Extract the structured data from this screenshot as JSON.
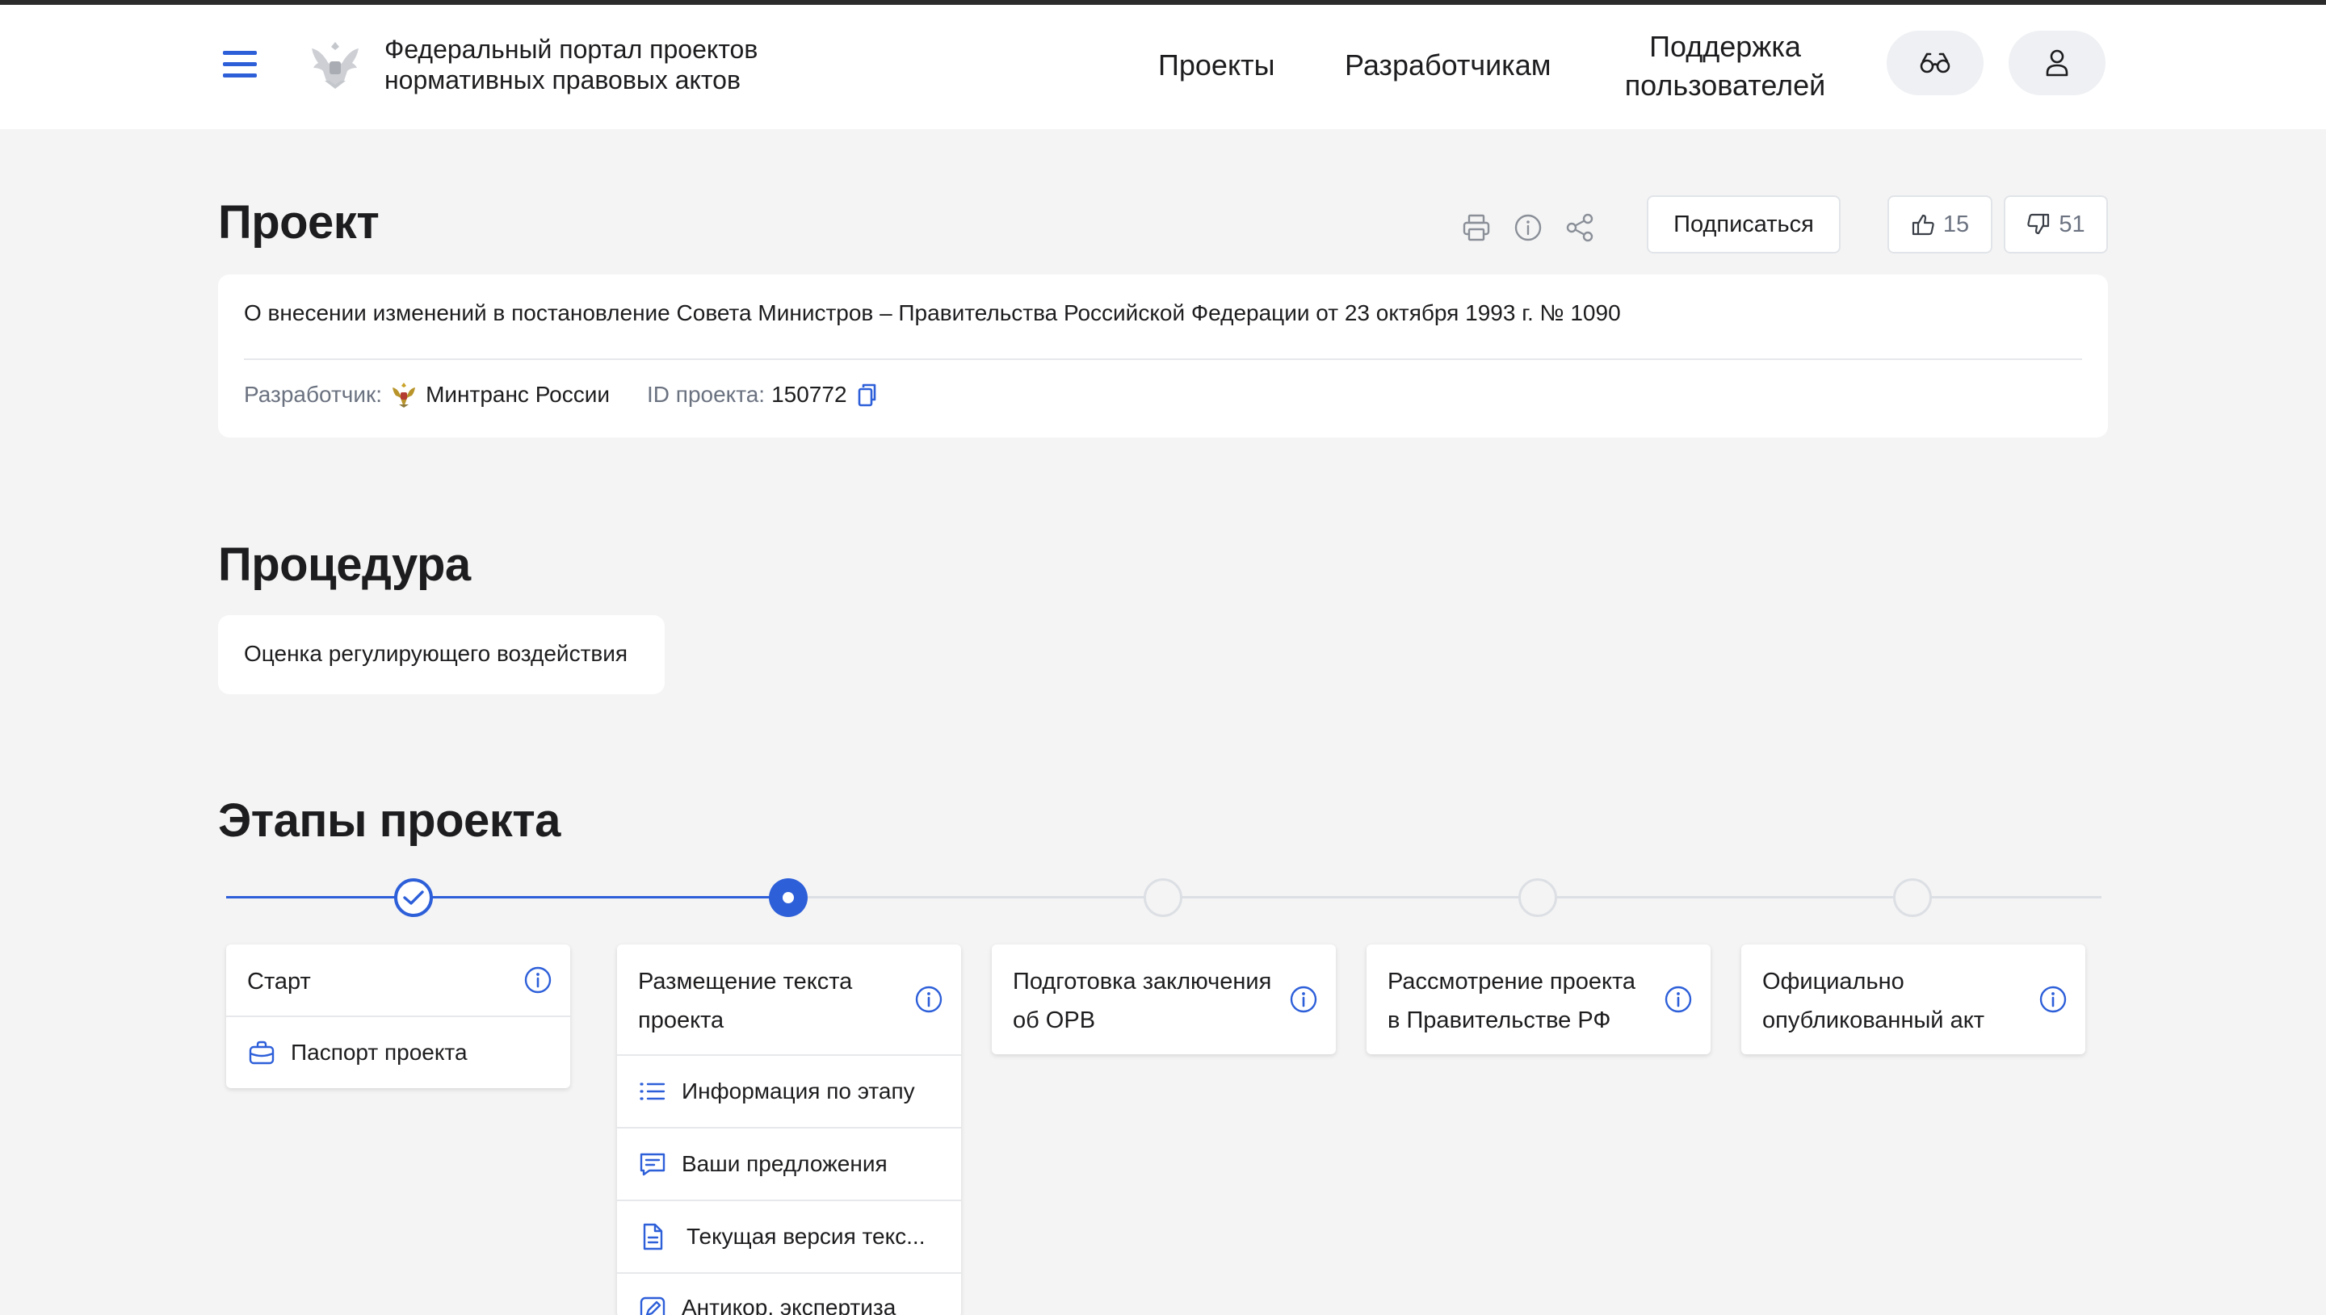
{
  "header": {
    "portal_title_line1": "Федеральный портал проектов",
    "portal_title_line2": "нормативных правовых актов",
    "nav": {
      "projects": "Проекты",
      "developers": "Разработчикам",
      "support": "Поддержка пользователей"
    }
  },
  "project": {
    "heading": "Проект",
    "subscribe_label": "Подписаться",
    "likes": "15",
    "dislikes": "51",
    "title": "О внесении изменений в постановление Совета Министров – Правительства Российской Федерации от 23 октября 1993 г. № 1090",
    "developer_label": "Разработчик:",
    "developer_name": "Минтранс России",
    "id_label": "ID проекта:",
    "id_value": "150772"
  },
  "procedure": {
    "heading": "Процедура",
    "value": "Оценка регулирующего воздействия"
  },
  "stages": {
    "heading": "Этапы проекта",
    "items": [
      {
        "title": "Старт",
        "status": "done",
        "subitems": [
          "Паспорт проекта"
        ]
      },
      {
        "title": "Размещение текста проекта",
        "status": "active",
        "subitems": [
          "Информация по этапу",
          "Ваши предложения",
          "Текущая версия текс...",
          "Антикор. экспертиза"
        ]
      },
      {
        "title": "Подготовка заключения об ОРВ",
        "status": "pending",
        "subitems": []
      },
      {
        "title": "Рассмотрение проекта в Правительстве РФ",
        "status": "pending",
        "subitems": []
      },
      {
        "title": "Официально опубликованный акт",
        "status": "pending",
        "subitems": []
      }
    ]
  },
  "colors": {
    "accent": "#2d5fd9",
    "background": "#f4f4f4",
    "muted": "#6b7280"
  }
}
